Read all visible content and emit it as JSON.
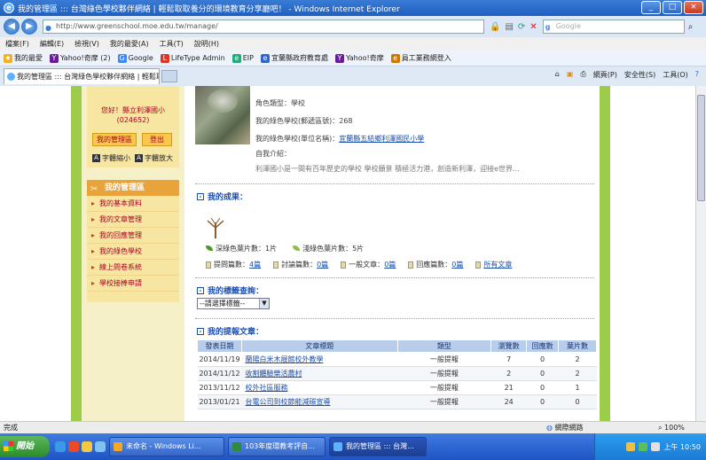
{
  "window": {
    "title": "我的管理區 ::: 台灣綠色學校夥伴網絡 | 輕鬆取取養分的環境教育分享廳吧！ - Windows Internet Explorer",
    "minimize": "_",
    "maximize": "□",
    "close": "×"
  },
  "address": {
    "url": "http://www.greenschool.moe.edu.tw/manage/",
    "search_placeholder": "Google"
  },
  "menu": [
    "檔案(F)",
    "編輯(E)",
    "檢視(V)",
    "我的最愛(A)",
    "工具(T)",
    "說明(H)"
  ],
  "favorites": [
    {
      "label": "我的最愛",
      "icon": "star-icon",
      "color": "#f0b020"
    },
    {
      "label": "Yahoo!奇摩 (2)",
      "icon": "yahoo-icon",
      "color": "#6a1b9a"
    },
    {
      "label": "Google",
      "icon": "google-icon",
      "color": "#4285f4"
    },
    {
      "label": "LifeType Admin",
      "icon": "lifetype-icon",
      "color": "#d32"
    },
    {
      "label": "EIP",
      "icon": "eip-icon",
      "color": "#2a7"
    },
    {
      "label": "宜蘭縣政府教育處",
      "icon": "gov-icon",
      "color": "#36c"
    },
    {
      "label": "Yahoo!奇摩",
      "icon": "yahoo-icon",
      "color": "#6a1b9a"
    },
    {
      "label": "員工業務網登入",
      "icon": "login-icon",
      "color": "#c70"
    }
  ],
  "tab": {
    "label": "我的管理區 ::: 台灣綠色學校夥伴網絡 | 輕鬆取取..."
  },
  "commands": [
    "網頁(P)",
    "安全性(S)",
    "工具(O)"
  ],
  "sidebar": {
    "greeting": "您好！縣立利澤國小",
    "user_id": "(024652)",
    "manage_button": "我的管理區",
    "logout_button": "登出",
    "font_small": "字體縮小",
    "font_large": "字體放大",
    "menu_title": "我的管理區",
    "menu_items": [
      "我的基本資料",
      "我的文章管理",
      "我的回應管理",
      "我的綠色學校",
      "線上問卷系統",
      "學校接棒申請"
    ]
  },
  "profile": {
    "role": "角色類型：學校",
    "zipcode": "我的綠色學校(郵遞區號)：268",
    "school_label": "我的綠色學校(單位名稱)：",
    "school_link": "宜蘭縣五結鄉利澤國民小學",
    "intro_label": "自我介紹：",
    "intro_text": "利澤國小是一間有百年歷史的學校 學校願景 積極活力港，創造新利澤，迎接e世界..."
  },
  "achievements": {
    "title": "我的成果：",
    "leaf_deep": "深綠色葉片數：",
    "leaf_deep_value": "1片",
    "leaf_light": "淺綠色葉片數：",
    "leaf_light_value": "5片",
    "items": [
      {
        "label": "提問篇數：",
        "value": "4篇"
      },
      {
        "label": "討論篇數：",
        "value": "0篇"
      },
      {
        "label": "一般文章：",
        "value": "0篇"
      },
      {
        "label": "回應篇數：",
        "value": "0篇"
      }
    ],
    "all_articles": "所有文章"
  },
  "tags": {
    "title": "我的標籤查詢：",
    "select_value": "--請選擇標籤--"
  },
  "articles": {
    "title": "我的提報文章：",
    "headers": [
      "發表日期",
      "文章標題",
      "類型",
      "瀏覽數",
      "回應數",
      "葉片數"
    ],
    "rows": [
      [
        "2014/11/19",
        "蘭陽白米木屐館校外教學",
        "一般提報",
        "7",
        "0",
        "2"
      ],
      [
        "2014/11/12",
        "收割體驗樂活農村",
        "一般提報",
        "2",
        "0",
        "2"
      ],
      [
        "2013/11/12",
        "校外社區服務",
        "一般提報",
        "21",
        "0",
        "1"
      ],
      [
        "2013/01/21",
        "台電公司到校節能減碳宣導",
        "一般提報",
        "24",
        "0",
        "0"
      ]
    ]
  },
  "status": {
    "left": "完成",
    "zone": "網際網路",
    "zoom": "100%"
  },
  "taskbar": {
    "start": "開始",
    "tasks": [
      "未命名 - Windows Li...",
      "103年度環教考評自...",
      "我的管理區 ::: 台灣..."
    ],
    "clock": "上午 10:50"
  }
}
